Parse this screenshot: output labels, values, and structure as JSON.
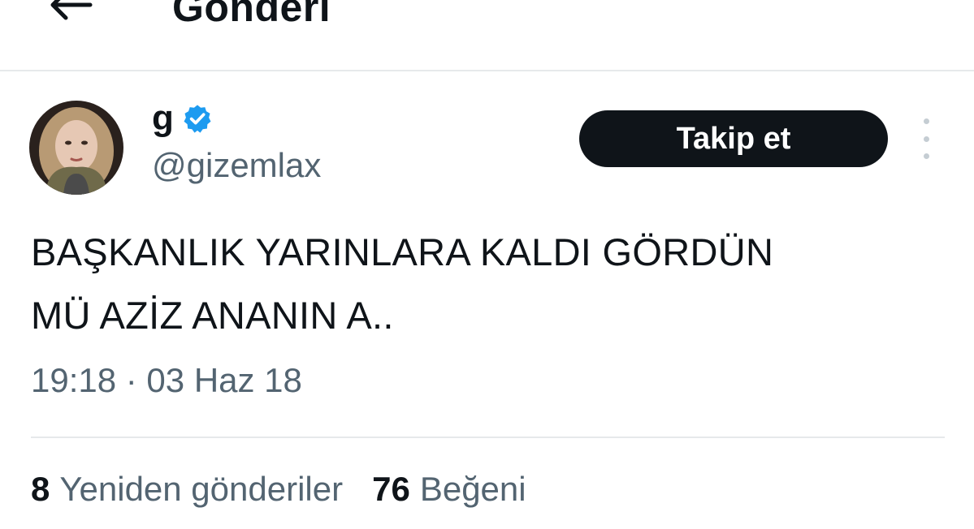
{
  "header": {
    "title": "Gönderi",
    "back_icon": "arrow-left-icon"
  },
  "tweet": {
    "author": {
      "display_name": "g",
      "handle": "@gizemlax",
      "verified": true,
      "verified_color": "#1d9bf0"
    },
    "follow_label": "Takip et",
    "more_icon": "more-vertical-icon",
    "text_line1": "BAŞKANLIK YARINLARA KALDI GÖRDÜN",
    "text_line2": "MÜ AZİZ ANANIN A..",
    "timestamp": "19:18 · 03 Haz 18",
    "stats": {
      "retweets_count": "8",
      "retweets_label": "Yeniden gönderiler",
      "likes_count": "76",
      "likes_label": "Beğeni"
    }
  }
}
